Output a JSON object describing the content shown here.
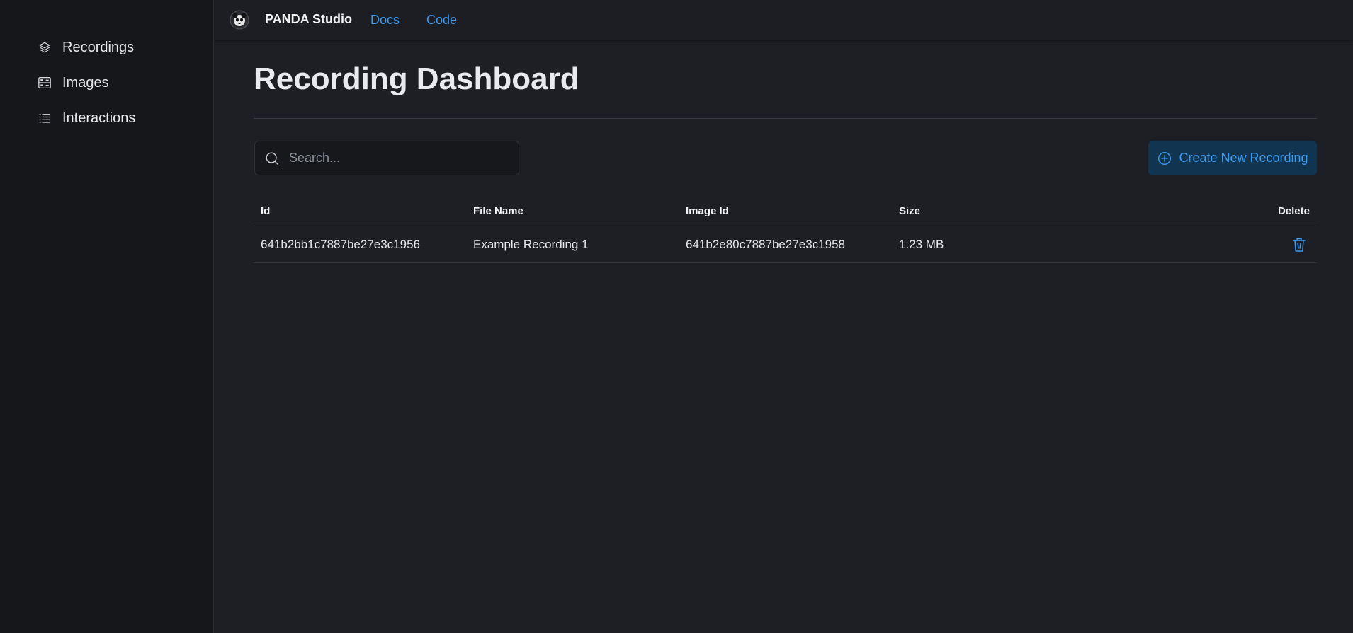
{
  "sidebar": {
    "items": [
      {
        "label": "Recordings",
        "icon": "layers-icon"
      },
      {
        "label": "Images",
        "icon": "server-icon"
      },
      {
        "label": "Interactions",
        "icon": "list-icon"
      }
    ]
  },
  "topbar": {
    "brand": "PANDA Studio",
    "links": [
      {
        "label": "Docs"
      },
      {
        "label": "Code"
      }
    ]
  },
  "main": {
    "title": "Recording Dashboard",
    "search": {
      "placeholder": "Search...",
      "value": ""
    },
    "create_button": "Create New Recording"
  },
  "table": {
    "headers": {
      "id": "Id",
      "file_name": "File Name",
      "image_id": "Image Id",
      "size": "Size",
      "delete": "Delete"
    },
    "rows": [
      {
        "id": "641b2bb1c7887be27e3c1956",
        "file_name": "Example Recording 1",
        "image_id": "641b2e80c7887be27e3c1958",
        "size": "1.23 MB"
      }
    ]
  },
  "colors": {
    "accent": "#3a9bf0",
    "background": "#1e1f24",
    "sidebar": "#16171b",
    "button_bg": "#113451"
  }
}
